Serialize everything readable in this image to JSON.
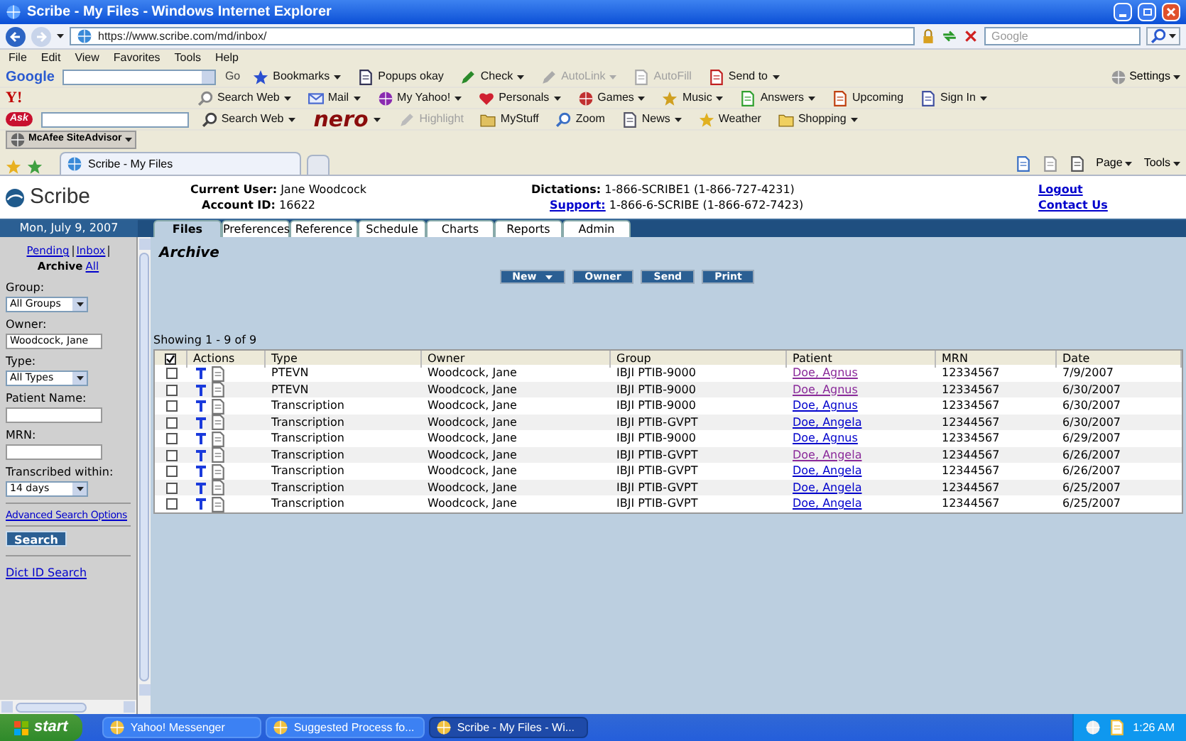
{
  "window": {
    "title": "Scribe - My Files - Windows Internet Explorer",
    "url": "https://www.scribe.com/md/inbox/",
    "search_placeholder": "Google"
  },
  "menu": [
    "File",
    "Edit",
    "View",
    "Favorites",
    "Tools",
    "Help"
  ],
  "google_toolbar": {
    "logo": "Google",
    "go": "Go",
    "items": [
      {
        "label": "Bookmarks",
        "dropdown": true,
        "disabled": false
      },
      {
        "label": "Popups okay",
        "dropdown": false,
        "disabled": false
      },
      {
        "label": "Check",
        "dropdown": true,
        "disabled": false
      },
      {
        "label": "AutoLink",
        "dropdown": true,
        "disabled": true
      },
      {
        "label": "AutoFill",
        "dropdown": false,
        "disabled": true
      },
      {
        "label": "Send to",
        "dropdown": true,
        "disabled": false
      }
    ],
    "settings": "Settings"
  },
  "yahoo_toolbar": {
    "logo": "Y!",
    "items": [
      {
        "label": "Search Web",
        "dropdown": true,
        "disabled": false
      },
      {
        "label": "Mail",
        "dropdown": true,
        "disabled": false
      },
      {
        "label": "My Yahoo!",
        "dropdown": true,
        "disabled": false
      },
      {
        "label": "Personals",
        "dropdown": true,
        "disabled": false
      },
      {
        "label": "Games",
        "dropdown": true,
        "disabled": false
      },
      {
        "label": "Music",
        "dropdown": true,
        "disabled": false
      },
      {
        "label": "Answers",
        "dropdown": true,
        "disabled": false
      },
      {
        "label": "Upcoming",
        "dropdown": false,
        "disabled": false
      },
      {
        "label": "Sign In",
        "dropdown": true,
        "disabled": false
      }
    ]
  },
  "ask_toolbar": {
    "logo": "Ask",
    "items": [
      {
        "kind": "button",
        "label": "Search Web",
        "dropdown": true,
        "disabled": false
      },
      {
        "kind": "logo",
        "label": "nero",
        "dropdown": true
      },
      {
        "kind": "button",
        "label": "Highlight",
        "dropdown": false,
        "disabled": true
      },
      {
        "kind": "button",
        "label": "MyStuff",
        "dropdown": false,
        "disabled": false
      },
      {
        "kind": "button",
        "label": "Zoom",
        "dropdown": false,
        "disabled": false
      },
      {
        "kind": "button",
        "label": "News",
        "dropdown": true,
        "disabled": false
      },
      {
        "kind": "button",
        "label": "Weather",
        "dropdown": false,
        "disabled": false
      },
      {
        "kind": "button",
        "label": "Shopping",
        "dropdown": true,
        "disabled": false
      }
    ]
  },
  "siteadvisor": "McAfee SiteAdvisor",
  "browser_tab": "Scribe - My Files",
  "command_bar": [
    "Page",
    "Tools"
  ],
  "header": {
    "logo": "Scribe",
    "current_user_label": "Current User:",
    "current_user": "Jane Woodcock",
    "account_label": "Account ID:",
    "account_id": "16622",
    "dictations_label": "Dictations:",
    "dictations": "1-866-SCRIBE1 (1-866-727-4231)",
    "support_label": "Support:",
    "support": "1-866-6-SCRIBE (1-866-672-7423)",
    "links": [
      "Logout",
      "Contact Us"
    ]
  },
  "date": "Mon, July 9, 2007",
  "tabs": [
    {
      "label": "Files",
      "selected": true
    },
    {
      "label": "Preferences",
      "selected": false
    },
    {
      "label": "Reference",
      "selected": false
    },
    {
      "label": "Schedule",
      "selected": false
    },
    {
      "label": "Charts",
      "selected": false
    },
    {
      "label": "Reports",
      "selected": false
    },
    {
      "label": "Admin",
      "selected": false
    }
  ],
  "sidebar": {
    "views": [
      {
        "label": "Pending",
        "selected": false
      },
      {
        "label": "Inbox",
        "selected": false
      },
      {
        "label": "Archive",
        "selected": true
      },
      {
        "label": "All",
        "selected": false
      }
    ],
    "fields": [
      {
        "label": "Group:",
        "kind": "select",
        "value": "All Groups"
      },
      {
        "label": "Owner:",
        "kind": "text",
        "value": "Woodcock, Jane"
      },
      {
        "label": "Type:",
        "kind": "select",
        "value": "All Types"
      },
      {
        "label": "Patient Name:",
        "kind": "text"
      },
      {
        "label": "MRN:",
        "kind": "text"
      },
      {
        "label": "Transcribed within:",
        "kind": "select",
        "value": "14 days"
      }
    ],
    "advanced_link": "Advanced Search Options",
    "search_button": "Search",
    "dict_link": "Dict ID Search"
  },
  "heading": "Archive",
  "actions": [
    {
      "label": "New",
      "dropdown": true
    },
    {
      "label": "Owner",
      "dropdown": false
    },
    {
      "label": "Send",
      "dropdown": false
    },
    {
      "label": "Print",
      "dropdown": false
    }
  ],
  "showing": "Showing 1 - 9 of 9",
  "table": {
    "all_checked": true,
    "columns": [
      "Actions",
      "Type",
      "Owner",
      "Group",
      "Patient",
      "MRN",
      "Date"
    ],
    "rows": [
      {
        "checked": false,
        "type": "PTEVN",
        "owner": "Woodcock, Jane",
        "group": "IBJI PTIB-9000",
        "patient": "Doe, Agnus",
        "visited": true,
        "mrn": "12334567",
        "date": "7/9/2007"
      },
      {
        "checked": false,
        "type": "PTEVN",
        "owner": "Woodcock, Jane",
        "group": "IBJI PTIB-9000",
        "patient": "Doe, Agnus",
        "visited": true,
        "mrn": "12334567",
        "date": "6/30/2007"
      },
      {
        "checked": false,
        "type": "Transcription",
        "owner": "Woodcock, Jane",
        "group": "IBJI PTIB-9000",
        "patient": "Doe, Agnus",
        "visited": false,
        "mrn": "12334567",
        "date": "6/30/2007"
      },
      {
        "checked": false,
        "type": "Transcription",
        "owner": "Woodcock, Jane",
        "group": "IBJI PTIB-GVPT",
        "patient": "Doe, Angela",
        "visited": false,
        "mrn": "12344567",
        "date": "6/30/2007"
      },
      {
        "checked": false,
        "type": "Transcription",
        "owner": "Woodcock, Jane",
        "group": "IBJI PTIB-9000",
        "patient": "Doe, Agnus",
        "visited": false,
        "mrn": "12334567",
        "date": "6/29/2007"
      },
      {
        "checked": false,
        "type": "Transcription",
        "owner": "Woodcock, Jane",
        "group": "IBJI PTIB-GVPT",
        "patient": "Doe, Angela",
        "visited": true,
        "mrn": "12344567",
        "date": "6/26/2007"
      },
      {
        "checked": false,
        "type": "Transcription",
        "owner": "Woodcock, Jane",
        "group": "IBJI PTIB-GVPT",
        "patient": "Doe, Angela",
        "visited": false,
        "mrn": "12344567",
        "date": "6/26/2007"
      },
      {
        "checked": false,
        "type": "Transcription",
        "owner": "Woodcock, Jane",
        "group": "IBJI PTIB-GVPT",
        "patient": "Doe, Angela",
        "visited": false,
        "mrn": "12344567",
        "date": "6/25/2007"
      },
      {
        "checked": false,
        "type": "Transcription",
        "owner": "Woodcock, Jane",
        "group": "IBJI PTIB-GVPT",
        "patient": "Doe, Angela",
        "visited": false,
        "mrn": "12344567",
        "date": "6/25/2007"
      }
    ]
  },
  "taskbar": {
    "start": "start",
    "tasks": [
      {
        "label": "Yahoo! Messenger",
        "selected": false
      },
      {
        "label": "Suggested Process fo...",
        "selected": false
      },
      {
        "label": "Scribe - My Files - Wi...",
        "selected": true
      }
    ],
    "clock": "1:26 AM"
  }
}
